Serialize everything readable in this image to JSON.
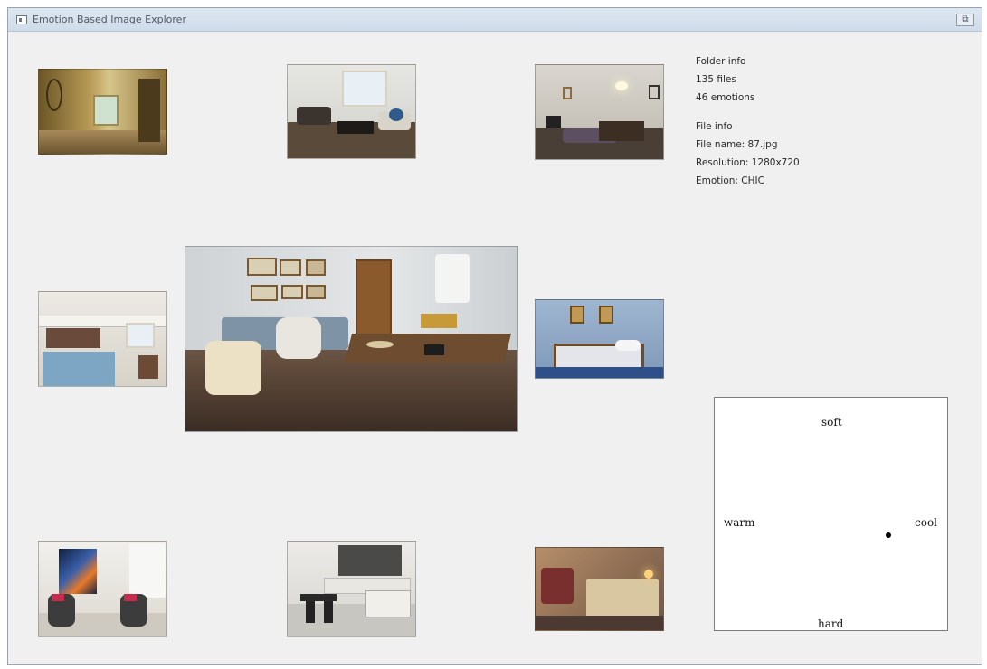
{
  "window": {
    "title": "Emotion Based Image Explorer",
    "close_glyph": "⧉"
  },
  "folder_info": {
    "heading": "Folder info",
    "files": "135 files",
    "emotions": "46 emotions"
  },
  "file_info": {
    "heading": "File info",
    "file_name": "File name: 87.jpg",
    "resolution": "Resolution: 1280x720",
    "emotion": "Emotion: CHIC"
  },
  "emotion_map": {
    "top": "soft",
    "bottom": "hard",
    "left": "warm",
    "right": "cool",
    "marker": {
      "warm_cool": 0.56,
      "soft_hard": -0.22
    }
  },
  "images": [
    {
      "name": "thumb-top-left",
      "scene": "hallway"
    },
    {
      "name": "thumb-top-center",
      "scene": "living-room"
    },
    {
      "name": "thumb-top-right",
      "scene": "living-room"
    },
    {
      "name": "thumb-middle-left",
      "scene": "kitchen"
    },
    {
      "name": "main-image",
      "scene": "living-room"
    },
    {
      "name": "thumb-middle-right",
      "scene": "bedroom"
    },
    {
      "name": "thumb-bottom-left",
      "scene": "lounge"
    },
    {
      "name": "thumb-bottom-center",
      "scene": "kitchen"
    },
    {
      "name": "thumb-bottom-right",
      "scene": "bedroom"
    }
  ]
}
